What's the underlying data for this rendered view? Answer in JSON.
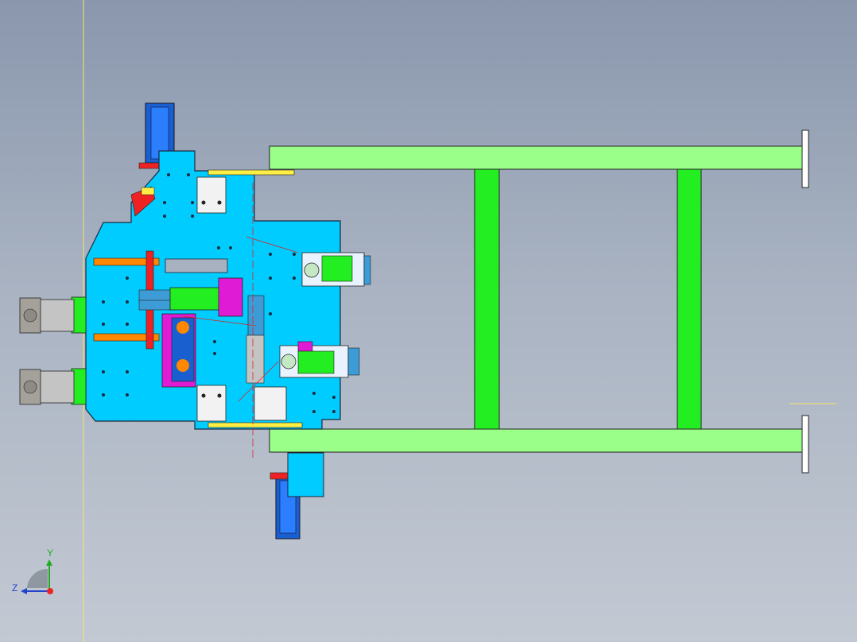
{
  "app": {
    "title": "",
    "view": "Top"
  },
  "colors": {
    "background_top": "#8a97ad",
    "background_bottom": "#c3c9d3",
    "frame_green": "#99ff88",
    "frame_green_dark": "#22ee22",
    "plate_blue": "#00ccff",
    "plate_blue_dark": "#3d9cd6",
    "cylinder_blue": "#1a5fd0",
    "magenta": "#e01bd6",
    "orange": "#ff8800",
    "yellow": "#ffee44",
    "red": "#ee2222",
    "guide_line": "#f0e86a"
  },
  "model": {
    "components": [
      {
        "name": "green-frame",
        "icon": "frame-rail-icon"
      },
      {
        "name": "mounting-plate",
        "icon": "plate-icon"
      },
      {
        "name": "cylinder-top",
        "icon": "cylinder-icon"
      },
      {
        "name": "cylinder-bottom",
        "icon": "cylinder-icon"
      },
      {
        "name": "motor-left-upper",
        "icon": "motor-icon"
      },
      {
        "name": "motor-left-lower",
        "icon": "motor-icon"
      },
      {
        "name": "gripper-upper",
        "icon": "gripper-icon"
      },
      {
        "name": "gripper-lower",
        "icon": "gripper-icon"
      }
    ]
  },
  "triad": {
    "y_label": "Y",
    "z_label": "Z"
  }
}
